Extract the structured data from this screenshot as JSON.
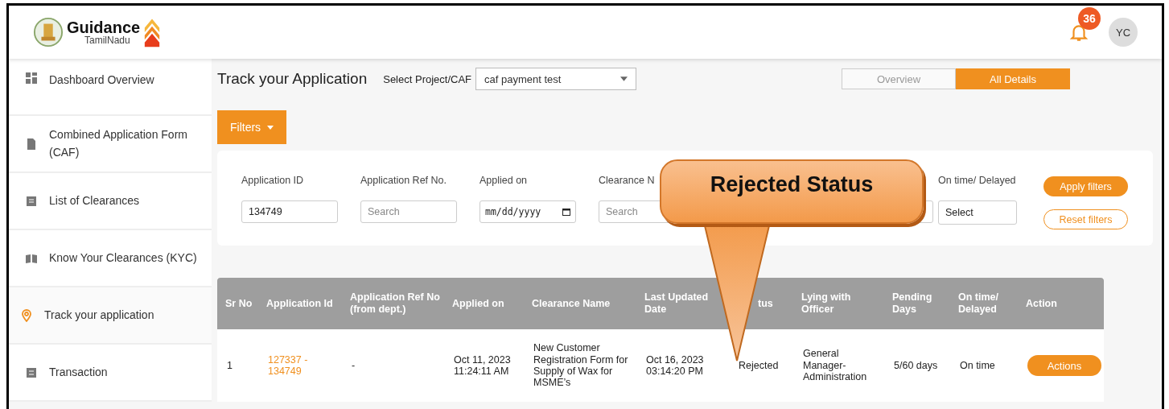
{
  "header": {
    "logo_title": "Guidance",
    "logo_subtitle": "TamilNadu",
    "notification_count": "36",
    "avatar": "YC"
  },
  "sidebar": {
    "items": [
      {
        "label": "Dashboard Overview",
        "selected": false
      },
      {
        "label": "Combined Application Form (CAF)",
        "selected": false
      },
      {
        "label": "List of Clearances",
        "selected": false
      },
      {
        "label": "Know Your Clearances (KYC)",
        "selected": false
      },
      {
        "label": "Track your application",
        "selected": true
      },
      {
        "label": "Transaction",
        "selected": false
      }
    ]
  },
  "page": {
    "title": "Track your Application",
    "project_label": "Select Project/CAF",
    "project_value": "caf payment test",
    "view_tabs": [
      {
        "label": "Overview",
        "selected": false
      },
      {
        "label": "All Details",
        "selected": true
      }
    ],
    "filters_button": "Filters"
  },
  "filters": {
    "fields": [
      {
        "label": "Application ID",
        "kind": "text",
        "value": "134749"
      },
      {
        "label": "Application Ref No.",
        "kind": "text",
        "placeholder": "Search"
      },
      {
        "label": "Applied on",
        "kind": "date",
        "placeholder": "mm/dd/yyyy"
      },
      {
        "label": "Clearance N",
        "kind": "text",
        "placeholder": "Search"
      },
      {
        "kind": "blank"
      },
      {
        "label": "On time/ Delayed",
        "kind": "select",
        "value": "Select"
      }
    ],
    "apply": "Apply filters",
    "reset": "Reset filters"
  },
  "table": {
    "columns": [
      "Sr No",
      "Application Id",
      "Application Ref No (from dept.)",
      "Applied on",
      "Clearance Name",
      "Last Updated Date",
      "tus",
      "Lying with Officer",
      "Pending Days",
      "On time/ Delayed",
      "Action"
    ],
    "rows": [
      {
        "cells": [
          "1",
          "127337 - 134749",
          "-",
          "Oct 11, 2023 11:24:11 AM",
          "New Customer Registration Form for Supply of Wax for MSME’s",
          "Oct 16, 2023 03:14:20 PM",
          "Rejected",
          "General Manager-Administration",
          "5/60 days",
          "On time"
        ],
        "action": "Actions"
      }
    ]
  },
  "callout": {
    "text": "Rejected Status"
  }
}
